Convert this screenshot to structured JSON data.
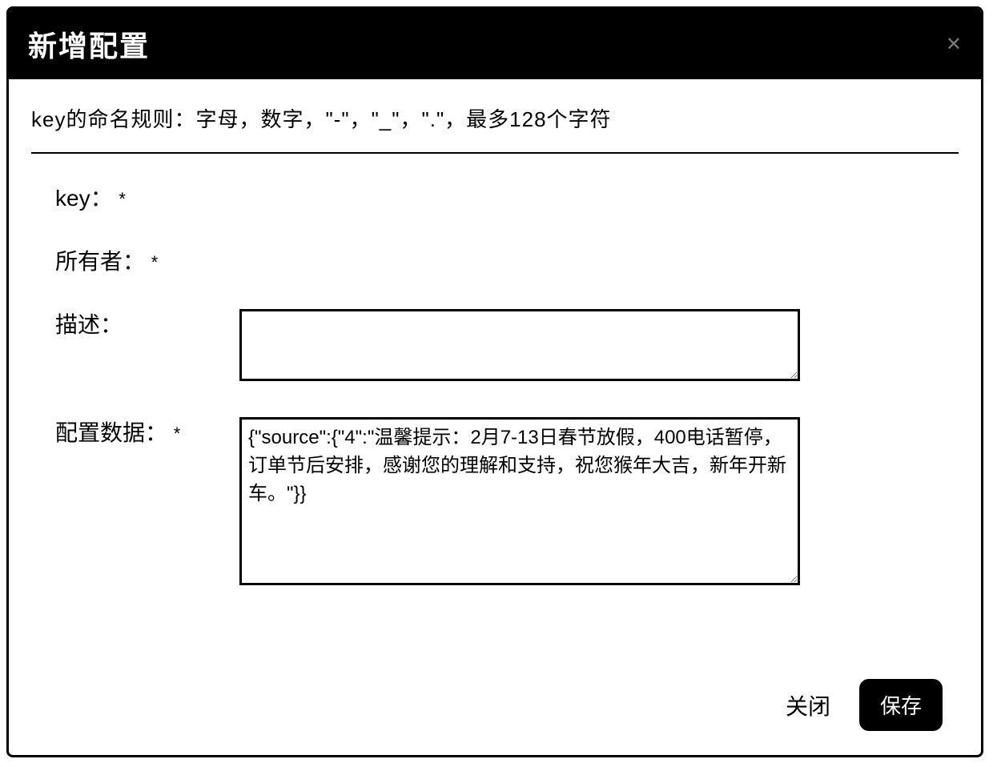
{
  "header": {
    "title": "新增配置",
    "close_icon": "✕"
  },
  "rule_text": "key的命名规则：字母，数字，\"-\"，\"_\"，\".\"，最多128个字符",
  "form": {
    "key": {
      "label": "key：",
      "required": "*",
      "value": ""
    },
    "owner": {
      "label": "所有者：",
      "required": "*",
      "value": ""
    },
    "description": {
      "label": "描述：",
      "value": ""
    },
    "config_data": {
      "label": "配置数据：",
      "required": "*",
      "value": "{\"source\":{\"4\":\"温馨提示：2月7-13日春节放假，400电话暂停，订单节后安排，感谢您的理解和支持，祝您猴年大吉，新年开新车。\"}}"
    }
  },
  "footer": {
    "close_label": "关闭",
    "save_label": "保存"
  }
}
